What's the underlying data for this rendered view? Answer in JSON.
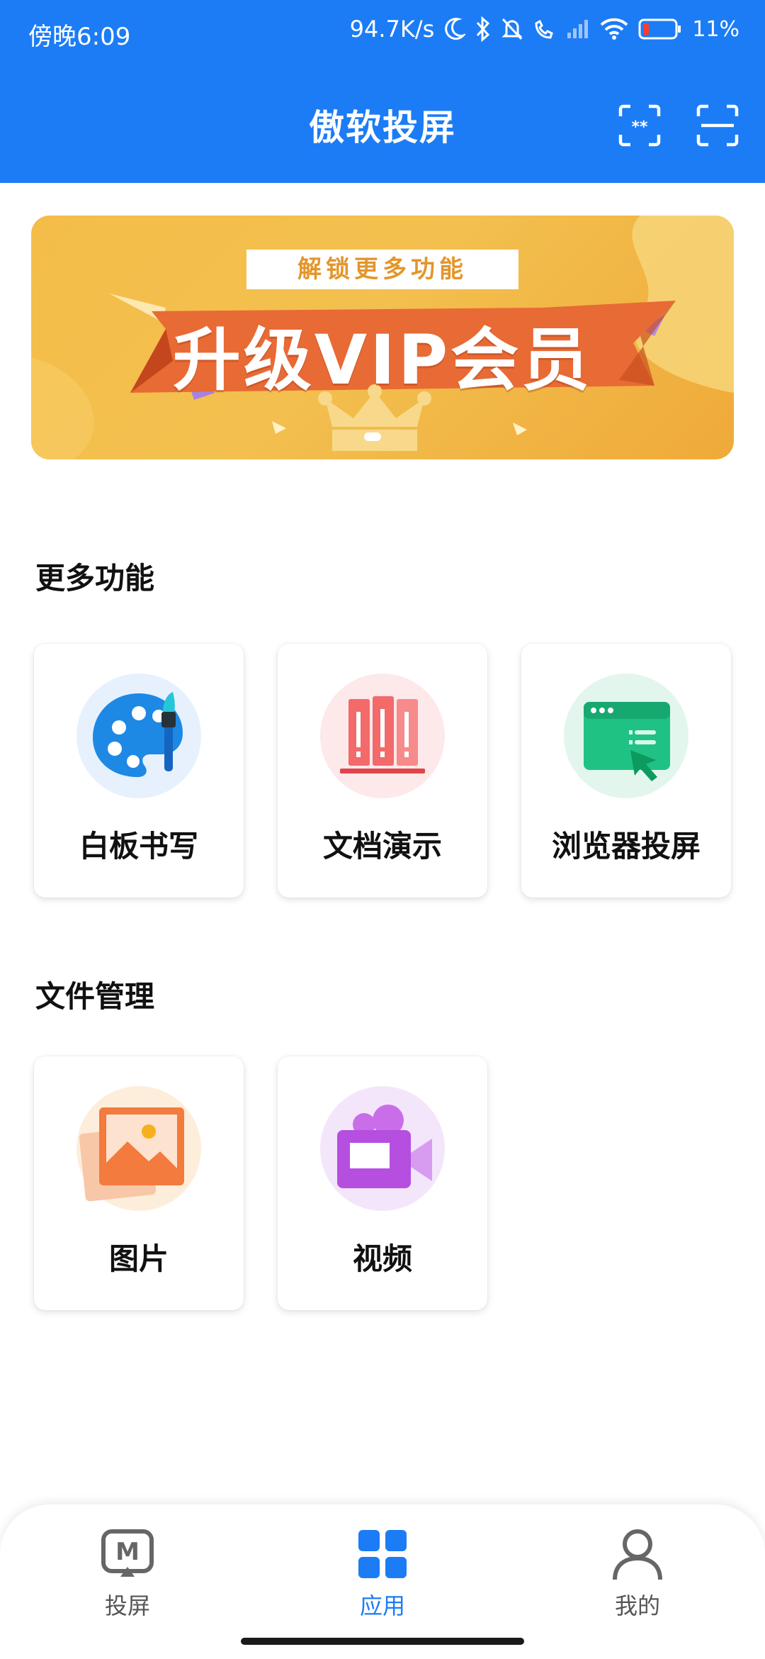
{
  "status_bar": {
    "time": "傍晚6:09",
    "network_speed": "94.7K/s",
    "battery": "11%"
  },
  "header": {
    "title": "傲软投屏",
    "background": "#1c7cf5",
    "icons": [
      "pin-code-scan-icon",
      "qr-scan-icon"
    ]
  },
  "banner": {
    "tag": "解锁更多功能",
    "main": "升级VIP会员"
  },
  "sections": {
    "more_features": {
      "title": "更多功能",
      "items": [
        {
          "label": "白板书写",
          "icon": "palette-icon"
        },
        {
          "label": "文档演示",
          "icon": "books-icon"
        },
        {
          "label": "浏览器投屏",
          "icon": "browser-icon"
        }
      ]
    },
    "file_management": {
      "title": "文件管理",
      "items": [
        {
          "label": "图片",
          "icon": "image-icon"
        },
        {
          "label": "视频",
          "icon": "video-camera-icon"
        }
      ]
    }
  },
  "bottom_nav": {
    "items": [
      {
        "label": "投屏",
        "icon": "cast-icon",
        "active": false
      },
      {
        "label": "应用",
        "icon": "apps-grid-icon",
        "active": true
      },
      {
        "label": "我的",
        "icon": "user-icon",
        "active": false
      }
    ],
    "active_color": "#1c7cf5"
  }
}
